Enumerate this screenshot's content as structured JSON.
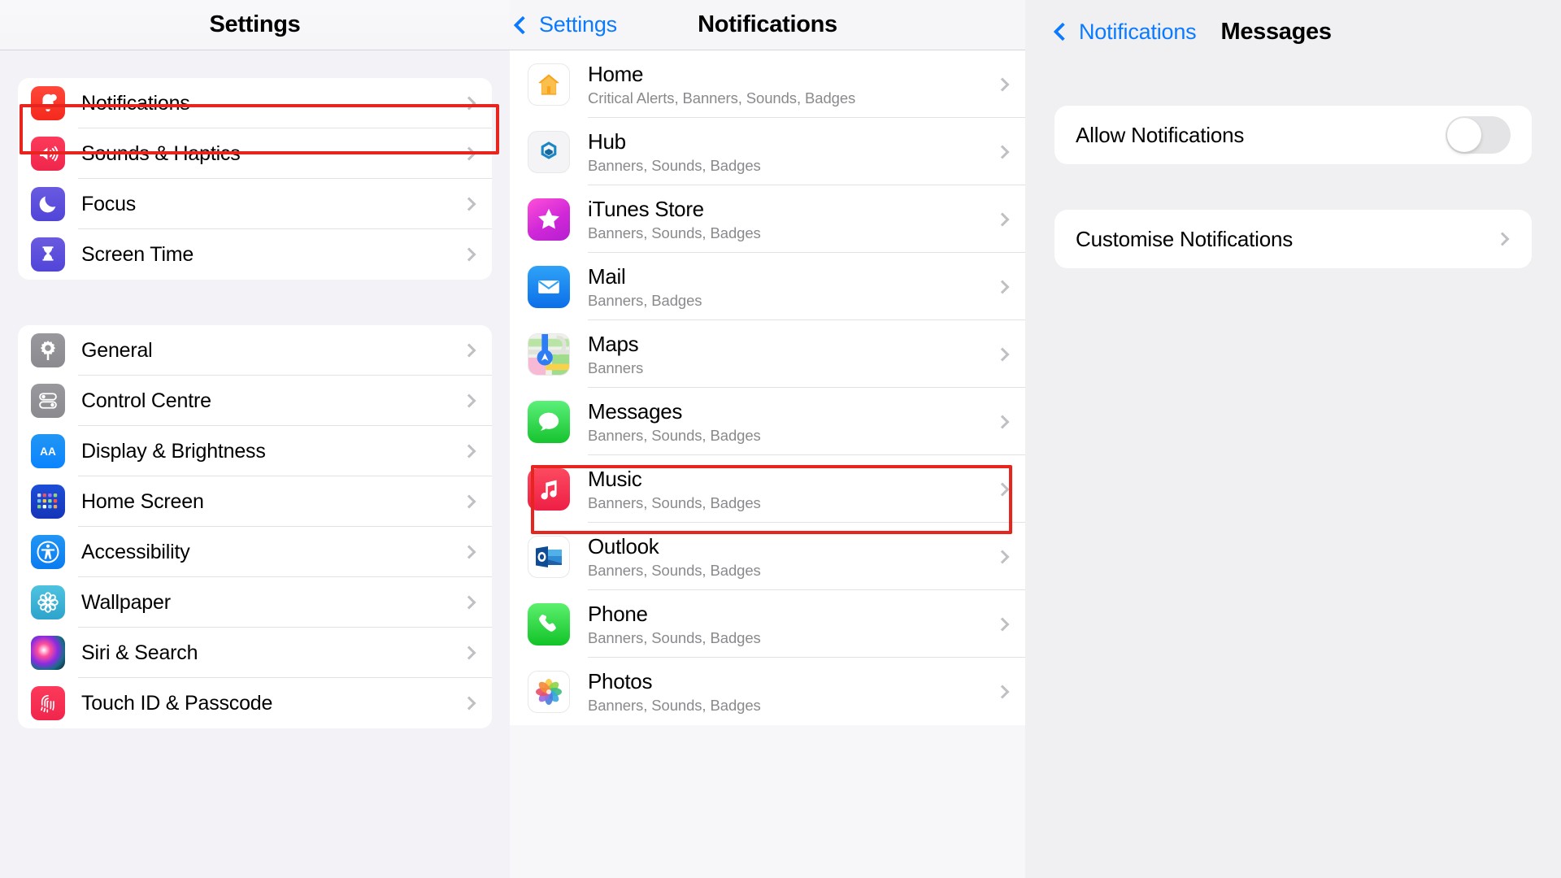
{
  "panels": {
    "left": {
      "title": "Settings",
      "groups": [
        {
          "items": [
            {
              "label": "Notifications",
              "icon": "bell-icon",
              "bg": "bg-notif",
              "highlighted": true
            },
            {
              "label": "Sounds & Haptics",
              "icon": "speaker-icon",
              "bg": "bg-sounds"
            },
            {
              "label": "Focus",
              "icon": "moon-icon",
              "bg": "bg-focus"
            },
            {
              "label": "Screen Time",
              "icon": "hourglass-icon",
              "bg": "bg-screen"
            }
          ]
        },
        {
          "items": [
            {
              "label": "General",
              "icon": "gear-icon",
              "bg": "bg-general"
            },
            {
              "label": "Control Centre",
              "icon": "toggles-icon",
              "bg": "bg-control"
            },
            {
              "label": "Display & Brightness",
              "icon": "aa-icon",
              "bg": "bg-display"
            },
            {
              "label": "Home Screen",
              "icon": "grid-icon",
              "bg": "bg-home"
            },
            {
              "label": "Accessibility",
              "icon": "accessibility-icon",
              "bg": "bg-access"
            },
            {
              "label": "Wallpaper",
              "icon": "flower-icon",
              "bg": "bg-wall"
            },
            {
              "label": "Siri & Search",
              "icon": "siri-orb-icon",
              "bg": "bg-siri"
            },
            {
              "label": "Touch ID & Passcode",
              "icon": "fingerprint-icon",
              "bg": "bg-touch"
            }
          ]
        }
      ]
    },
    "mid": {
      "back_label": "Settings",
      "title": "Notifications",
      "items": [
        {
          "name": "Home",
          "detail": "Critical Alerts, Banners, Sounds, Badges",
          "icon": "house-icon",
          "bg": "bg-app-home"
        },
        {
          "name": "Hub",
          "detail": "Banners, Sounds, Badges",
          "icon": "hub-icon",
          "bg": "bg-hub"
        },
        {
          "name": "iTunes Store",
          "detail": "Banners, Sounds, Badges",
          "icon": "star-icon",
          "bg": "bg-itunes"
        },
        {
          "name": "Mail",
          "detail": "Banners, Badges",
          "icon": "envelope-icon",
          "bg": "bg-mail"
        },
        {
          "name": "Maps",
          "detail": "Banners",
          "icon": "map-icon",
          "bg": "bg-maps"
        },
        {
          "name": "Messages",
          "detail": "Banners, Sounds, Badges",
          "icon": "speech-bubble-icon",
          "bg": "bg-msg",
          "highlighted": true
        },
        {
          "name": "Music",
          "detail": "Banners, Sounds, Badges",
          "icon": "music-note-icon",
          "bg": "bg-music"
        },
        {
          "name": "Outlook",
          "detail": "Banners, Sounds, Badges",
          "icon": "outlook-icon",
          "bg": "bg-outlook"
        },
        {
          "name": "Phone",
          "detail": "Banners, Sounds, Badges",
          "icon": "phone-handset-icon",
          "bg": "bg-phone"
        },
        {
          "name": "Photos",
          "detail": "Banners, Sounds, Badges",
          "icon": "pinwheel-icon",
          "bg": "bg-photos"
        }
      ]
    },
    "right": {
      "back_label": "Notifications",
      "title": "Messages",
      "allow_label": "Allow Notifications",
      "allow_state": "off",
      "customise_label": "Customise Notifications"
    }
  },
  "colors": {
    "accent_blue": "#0a7bff",
    "highlight_red": "#e8241f",
    "secondary_text": "#8a8a8e",
    "chevron_grey": "#bfbfc4"
  }
}
